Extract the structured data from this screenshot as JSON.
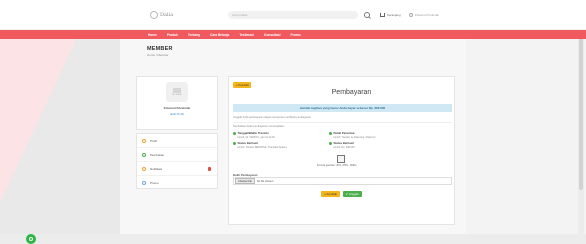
{
  "header": {
    "logo_text": "Dalia",
    "search_placeholder": "Cari produk",
    "cart_label": "Keranjang",
    "user_label": "Khusnul Khotimah"
  },
  "nav": {
    "items": [
      "Home",
      "Produk",
      "Tentang",
      "Cara Belanja",
      "Testimoni",
      "Konsultasi",
      "Promo"
    ]
  },
  "member": {
    "title": "MEMBER",
    "breadcrumb": "Home / Member"
  },
  "profile": {
    "avatar_caption": "NO IMAGE",
    "name": "Khusnul Khotimah",
    "edit_label": "[Edit Profil]"
  },
  "menu": {
    "items": [
      "Profil",
      "Pembelian",
      "Notifikasi",
      "Promo"
    ]
  },
  "payment": {
    "back_top_label": "« Kembali",
    "title": "Pembayaran",
    "amount_text": "Jumlah tagihan yang harus Anda bayar sebesar Rp. 396.000",
    "note1": "Unggah bukti pembayaran dapat memproses verifikasi pembayaran",
    "note2": "Tambahkan bukti pembayaran menampilkan:",
    "instructions": [
      {
        "title": "Tanggal/Waktu Transfer",
        "desc": "contoh: tgl. 04/06/19 - jam 10:12:00"
      },
      {
        "title": "Detail Penerima",
        "desc": "contoh: Transfer ke Rekening / Dalia Inc"
      },
      {
        "title": "Status Berhasil",
        "desc": "contoh: Transfer BERHASIL, Transaksi Sukses"
      },
      {
        "title": "Status Berhasil",
        "desc": "contoh: Rp. 396.000"
      }
    ],
    "format_caption": "Format gambar: JPG, PNG, JPEG",
    "upload_label": "Bukti Pembayaran",
    "file_button": "Choose File",
    "file_none": "No file chosen",
    "back_label": "« Kembali",
    "upload_button": "✔ Unggah"
  },
  "colors": {
    "nav": "#f05a5f",
    "warning": "#f3b51b",
    "success": "#4cae4c",
    "info_bg": "#cfe8f3"
  }
}
